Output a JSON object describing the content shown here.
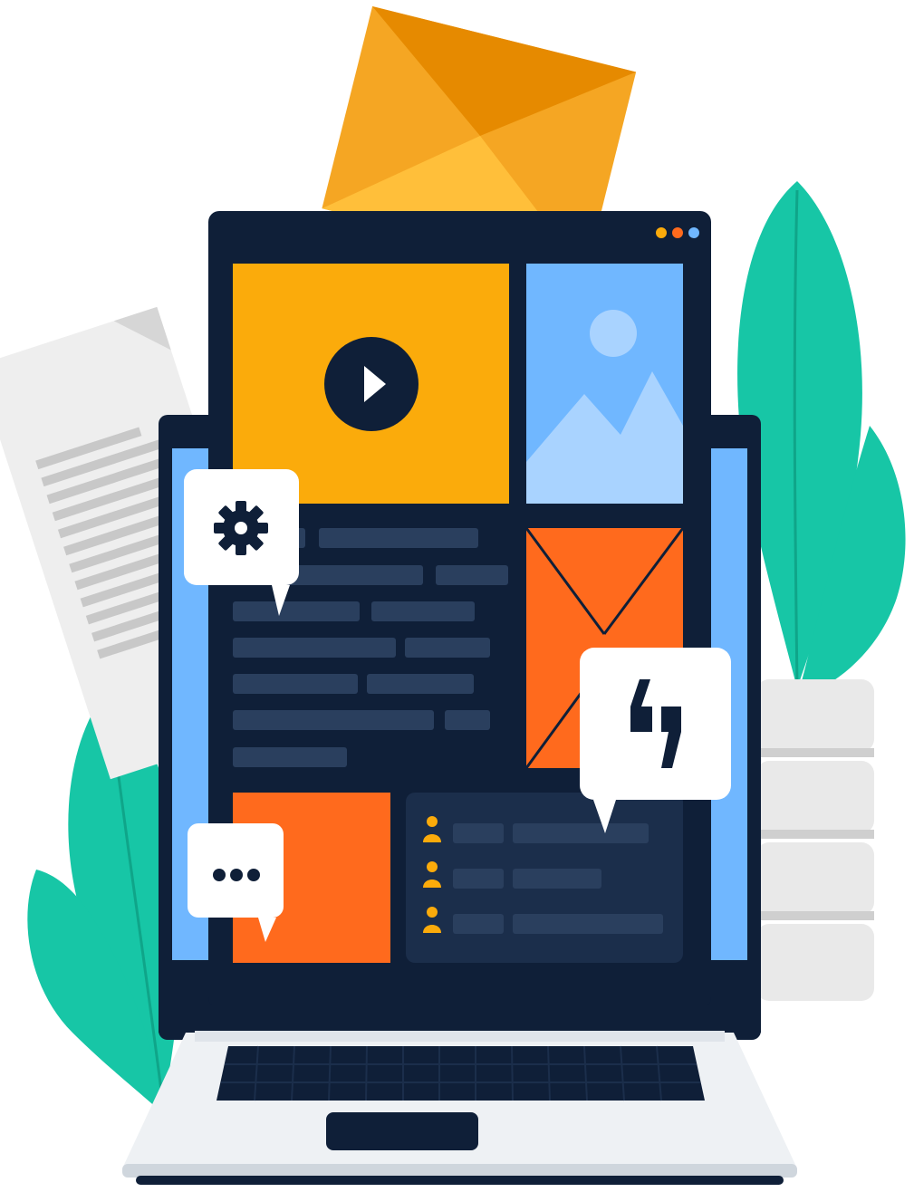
{
  "colors": {
    "navy": "#0f1f38",
    "panel": "#1b2e4b",
    "placeholder": "#2a3f5e",
    "amber": "#fbab0b",
    "orange": "#ff6a1d",
    "sky": "#70b7ff",
    "sky_light": "#a9d3ff",
    "teal": "#17c6a6",
    "paper": "#eeeeee",
    "laptop_base": "#eef1f4"
  },
  "window_dots": [
    {
      "name": "dot-amber",
      "color": "#fbab0b"
    },
    {
      "name": "dot-orange",
      "color": "#ff6a1d"
    },
    {
      "name": "dot-blue",
      "color": "#70b7ff"
    }
  ],
  "icons": {
    "play": "play-icon",
    "image": "image-icon",
    "mail": "envelope-icon",
    "settings": "gear-icon",
    "quote": "quote-icon",
    "more": "ellipsis-icon",
    "user": "user-icon"
  },
  "user_list_count": 3
}
